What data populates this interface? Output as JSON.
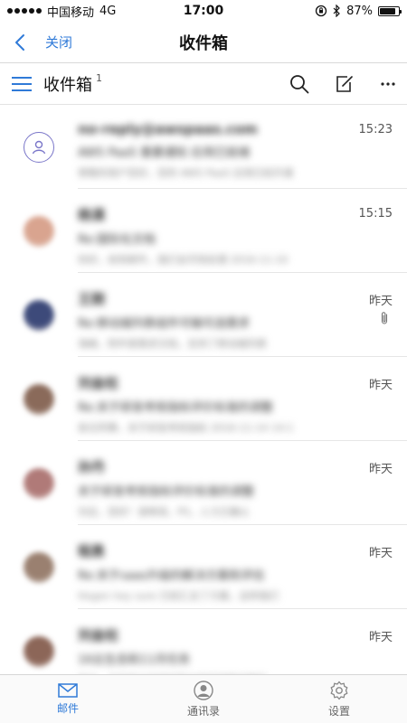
{
  "status_bar": {
    "carrier": "中国移动",
    "network": "4G",
    "time": "17:00",
    "battery": "87%",
    "battery_level": 0.87
  },
  "nav": {
    "back_label": "关闭",
    "title": "收件箱"
  },
  "toolbar": {
    "folder_title": "收件箱",
    "count": "1",
    "menu_icon": "hamburger-icon",
    "search_icon": "search-icon",
    "compose_icon": "compose-icon",
    "more_icon": "more-icon"
  },
  "messages": [
    {
      "sender": "no-reply@awspaas.com",
      "subject": "AWS PaaS 重要通知 应用已就绪",
      "preview": "尊敬的用户您好，您的 AWS PaaS 应用已经开通",
      "time": "15:23",
      "avatar_color": "#ffffff",
      "attachment": false,
      "placeholder_avatar": true
    },
    {
      "sender": "杨漠",
      "subject": "Re:国际化文档",
      "preview": "你好，收到邮件，我们会尽快处理 2016-11-10",
      "time": "15:15",
      "avatar_color": "#d9a48f",
      "attachment": false,
      "placeholder_avatar": false
    },
    {
      "sender": "王刚",
      "subject": "Re:移动端列表组件可输可选需求",
      "preview": "海峰，附件是需求文档，支持了移动端列表",
      "time": "昨天",
      "avatar_color": "#3d4a7a",
      "attachment": true,
      "placeholder_avatar": false
    },
    {
      "sender": "刘金柱",
      "subject": "Re:关于研发考核指标评价标准的调整",
      "preview": "各位同事，关于研发考核指标 2016-11-14 14:1",
      "time": "昨天",
      "avatar_color": "#8a6a5a",
      "attachment": false,
      "placeholder_avatar": false
    },
    {
      "sender": "孙丹",
      "subject": "关于研发考核指标评价标准的调整",
      "preview": "刘总，您好！请审阅，PS，人力已确认",
      "time": "昨天",
      "avatar_color": "#b07a78",
      "attachment": false,
      "placeholder_avatar": false
    },
    {
      "sender": "程勇",
      "subject": "Re:关于saas升级的解决方案和评估",
      "preview": "Hogen hey sure 已经汇总了方案，这样我们",
      "time": "昨天",
      "avatar_color": "#9a8070",
      "attachment": false,
      "placeholder_avatar": false
    },
    {
      "sender": "刘金柱",
      "subject": "16云生态和11月任务",
      "preview": "各位，今年的工作目标和计划已经基本确定",
      "time": "昨天",
      "avatar_color": "#8c6658",
      "attachment": false,
      "placeholder_avatar": false
    }
  ],
  "tabbar": {
    "tabs": [
      {
        "label": "邮件",
        "icon": "mail-icon",
        "active": true
      },
      {
        "label": "通讯录",
        "icon": "contacts-icon",
        "active": false
      },
      {
        "label": "设置",
        "icon": "settings-icon",
        "active": false
      }
    ]
  },
  "colors": {
    "accent": "#2f7ad8",
    "placeholder_avatar_border": "#7a76c9"
  }
}
